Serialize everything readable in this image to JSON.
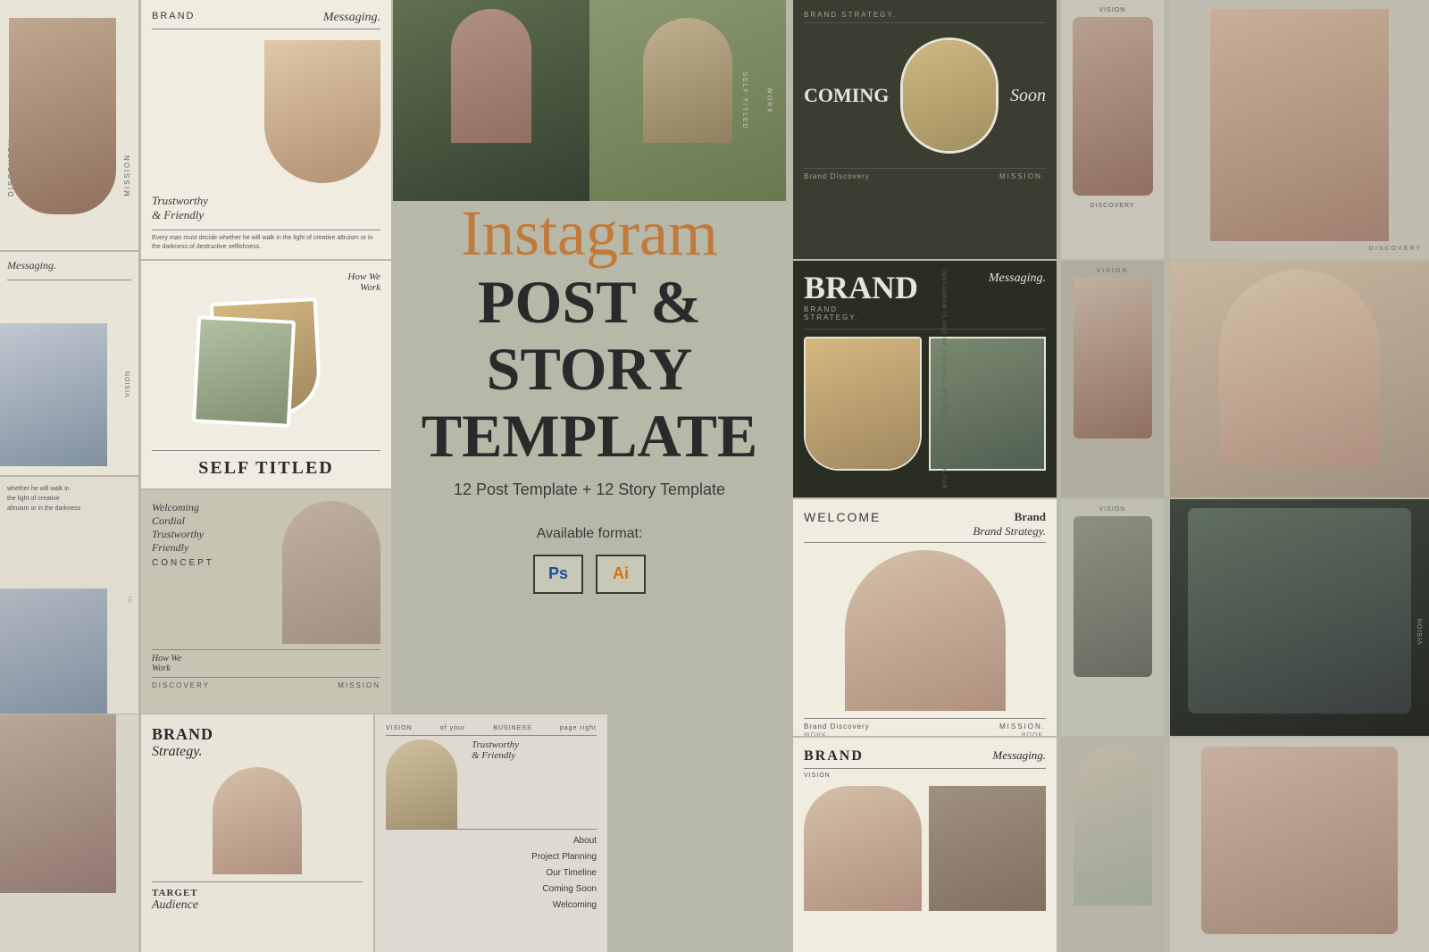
{
  "hero": {
    "title_script": "Instagram",
    "title_line1": "POST & STORY",
    "title_line2": "TEMPLATE",
    "subtitle": "12 Post Template + 12 Story Template",
    "format_label": "Available format:",
    "formats": [
      {
        "label": "Ps",
        "type": "ps"
      },
      {
        "label": "Ai",
        "type": "ai"
      }
    ]
  },
  "cards": {
    "brand_messaging": {
      "brand": "BRAND",
      "messaging": "Messaging.",
      "tagline1": "Trustworthy",
      "tagline2": "& Friendly",
      "body_text": "Every man must decide whether he will walk in the light of creative altruism or in the darkness of destructive selfishness."
    },
    "coming_soon": {
      "brand_strategy": "BRAND STRATEGY.",
      "coming": "COMING",
      "soon": "Soon",
      "brand_discovery": "Brand Discovery",
      "mission": "MISSION."
    },
    "self_titled": {
      "how_we": "How We",
      "work": "Work",
      "self_titled": "SELF TITLED"
    },
    "brand_dark": {
      "brand": "BRAND",
      "messaging": "Messaging.",
      "brand_label": "BRAND",
      "strategy": "STRATEGY."
    },
    "concept": {
      "welcoming": "Welcoming",
      "cordial": "Cordial",
      "trustworthy": "Trustworthy",
      "friendly": "Friendly",
      "concept": "CONCEPT",
      "how_we": "How We",
      "work": "Work",
      "discovery": "DISCOVERY",
      "mission": "MISSION"
    },
    "welcome": {
      "welcome": "WELCOME",
      "brand_strategy": "Brand Strategy.",
      "work": "WORK·",
      "book": "BOOK.",
      "brand_discovery": "Brand Discovery",
      "mission": "MISSION."
    },
    "brand_strategy_bottom": {
      "brand": "BRAND",
      "strategy": "Strategy.",
      "target": "TARGET",
      "audience": "Audience"
    },
    "vision_business": {
      "vision": "VISION",
      "of_your": "of your",
      "business": "BUSINESS",
      "page": "page right",
      "trustworthy": "Trustworthy",
      "friendly": "& Friendly",
      "about": "About",
      "project": "Project Planning",
      "timeline": "Our Timeline",
      "coming_soon": "Coming Soon",
      "welcoming": "Welcoming"
    },
    "brand_messaging_bottom": {
      "brand": "BRAND",
      "messaging": "Messaging.",
      "vision": "VISION"
    },
    "concept_top": {
      "concept": "CONCEPT"
    }
  },
  "colors": {
    "bg": "#b8b8a8",
    "dark_card": "#2a2d22",
    "cream": "#f0ece0",
    "tan": "#c8c4b4",
    "accent_script": "#c07a3a"
  }
}
